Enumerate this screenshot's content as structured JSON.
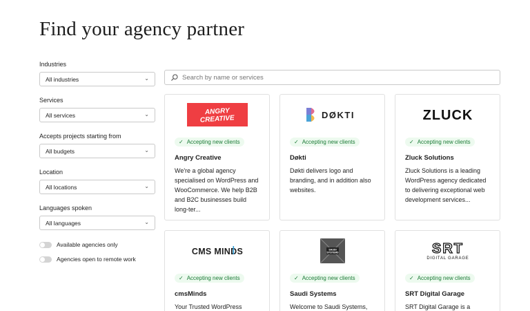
{
  "page": {
    "title": "Find your agency partner"
  },
  "filters": [
    {
      "label": "Industries",
      "value": "All industries"
    },
    {
      "label": "Services",
      "value": "All services"
    },
    {
      "label": "Accepts projects starting from",
      "value": "All budgets"
    },
    {
      "label": "Location",
      "value": "All locations"
    },
    {
      "label": "Languages spoken",
      "value": "All languages"
    }
  ],
  "toggles": [
    {
      "label": "Available agencies only"
    },
    {
      "label": "Agencies open to remote work"
    }
  ],
  "search": {
    "placeholder": "Search by name or services"
  },
  "cards": [
    {
      "logo_text": "ANGRY CREATIVE",
      "badge": "Accepting new clients",
      "name": "Angry Creative",
      "description": "We're a global agency specialised on WordPress and WooCommerce. We help B2B and B2C businesses build long-ter..."
    },
    {
      "logo_text": "DØKTI",
      "badge": "Accepting new clients",
      "name": "Døkti",
      "description": "Døkti delivers logo and branding, and in addition also websites."
    },
    {
      "logo_text": "ZLUCK",
      "badge": "Accepting new clients",
      "name": "Zluck Solutions",
      "description": "Zluck Solutions is a leading WordPress agency dedicated to delivering exceptional web development services..."
    },
    {
      "logo_text": "CMS MINDS",
      "badge": "Accepting new clients",
      "name": "cmsMinds",
      "description": "Your Trusted WordPress"
    },
    {
      "logo_text": "SAUDI SYSTEMS",
      "badge": "Accepting new clients",
      "name": "Saudi Systems",
      "description": "Welcome to Saudi Systems,"
    },
    {
      "logo_text": "SRT",
      "logo_sub": "DIGITAL GARAGE",
      "badge": "Accepting new clients",
      "name": "SRT Digital Garage",
      "description": "SRT Digital Garage is a"
    }
  ],
  "colors": {
    "badge_bg": "#edfaef",
    "badge_text": "#1a7a35",
    "angry_red": "#ef3e42"
  }
}
